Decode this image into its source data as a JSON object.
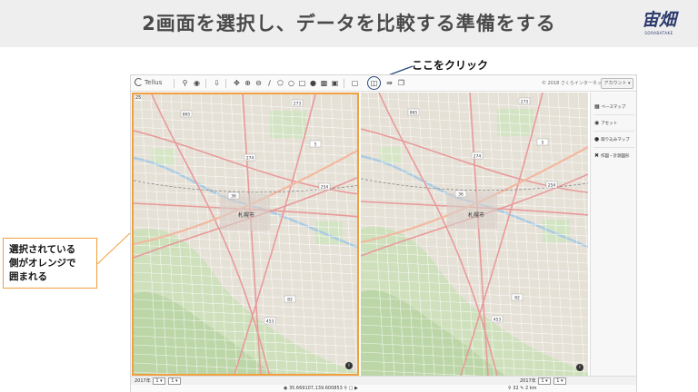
{
  "slide": {
    "title": "2画面を選択し、データを比較する準備をする",
    "logo_text": "宙畑",
    "logo_subtext": "SORABATAKE"
  },
  "callout": {
    "text": "ここをクリック"
  },
  "annotation": {
    "lines": [
      "選択されている",
      "側がオレンジで",
      "囲まれる"
    ]
  },
  "toolbar": {
    "brand": "Tellus",
    "copyright": "© 2018 さくらインターネット",
    "account_label": "アカウント"
  },
  "map": {
    "zoom_level": "25",
    "city_label": "札幌市",
    "route_labels": [
      "865",
      "273",
      "5",
      "274",
      "254",
      "36",
      "82",
      "453"
    ],
    "info_glyph": "i"
  },
  "side_panel": {
    "items": [
      {
        "icon": "layers-icon",
        "label": "ベースマップ"
      },
      {
        "icon": "asset-icon",
        "label": "アセット"
      },
      {
        "icon": "folder-icon",
        "label": "取り込みマップ"
      },
      {
        "icon": "tools-icon",
        "label": "作図・計測図形"
      }
    ]
  },
  "date_bar": {
    "left": {
      "year": "2017年",
      "month": "1",
      "day": "1"
    },
    "right": {
      "year": "2017年",
      "month": "1",
      "day": "1"
    }
  },
  "status": {
    "coordinates": "35.669107,139.600853",
    "zoom": "32",
    "scale": "2 km"
  }
}
